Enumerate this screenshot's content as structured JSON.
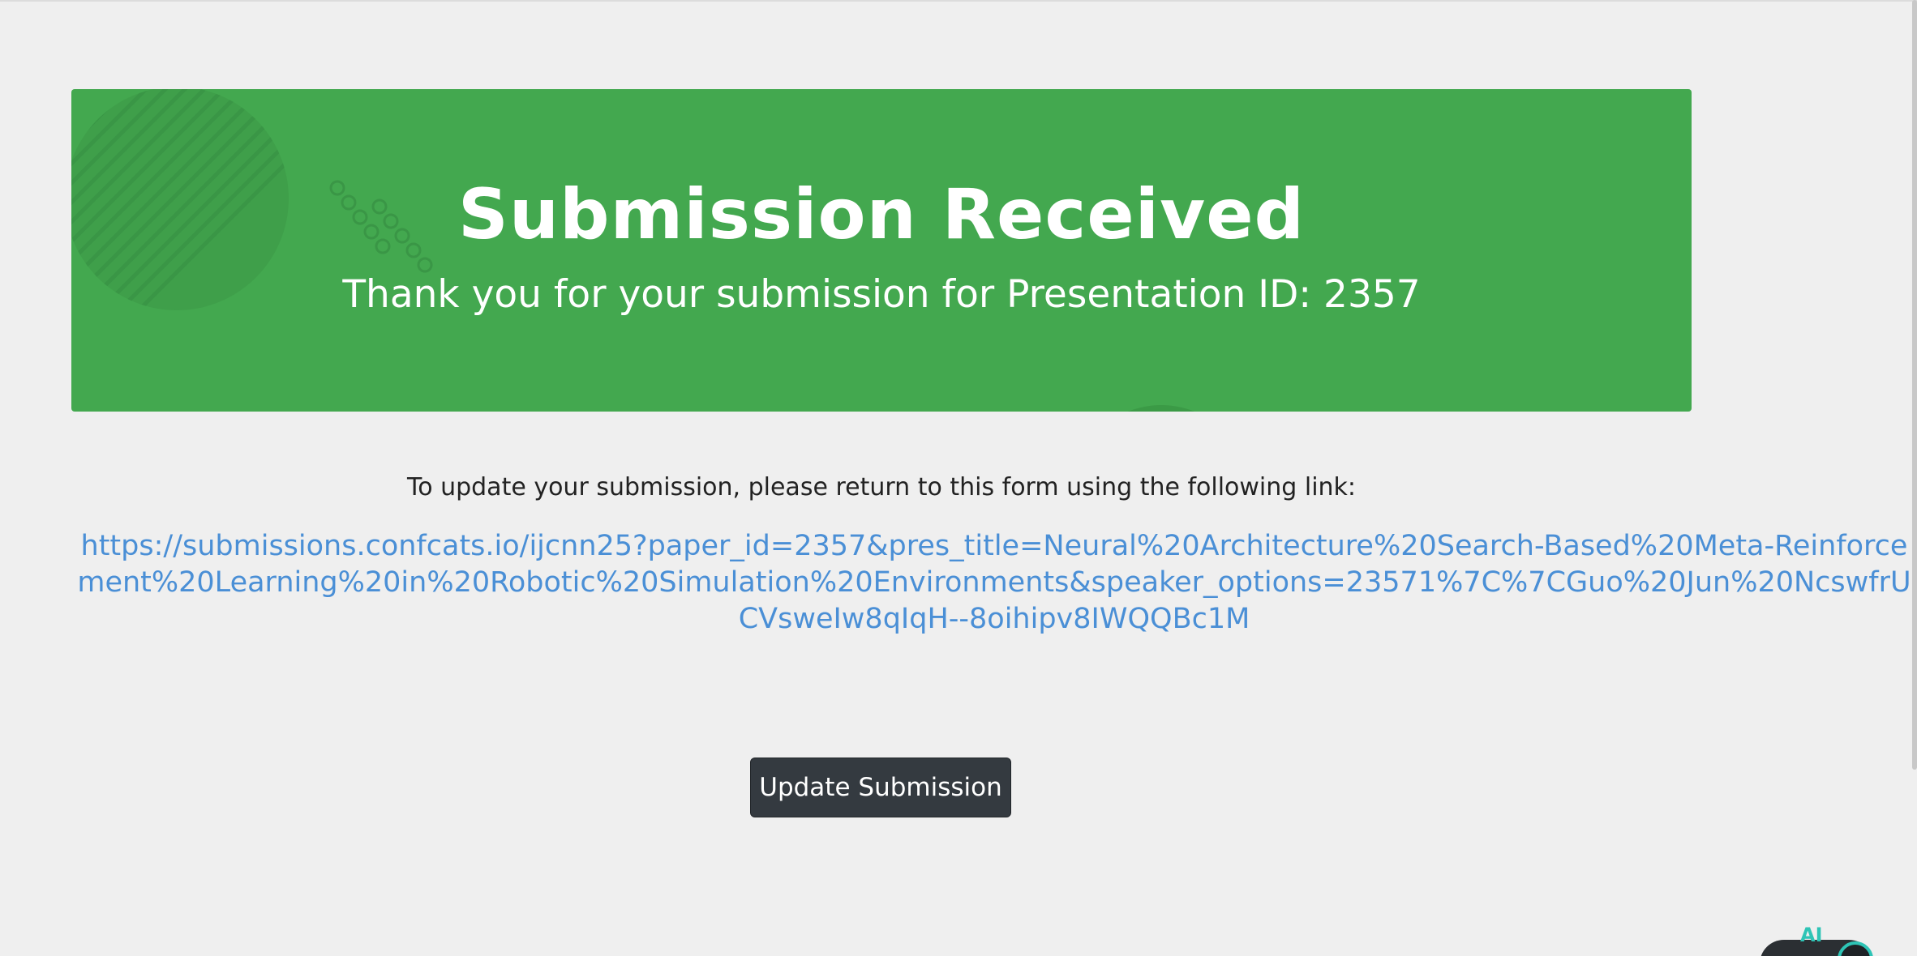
{
  "banner": {
    "title": "Submission Received",
    "subtitle": "Thank you for your submission for Presentation ID: 2357",
    "background_color": "#43a84f"
  },
  "main": {
    "instructions": "To update your submission, please return to this form using the following link:",
    "update_link": "https://submissions.confcats.io/ijcnn25?paper_id=2357&pres_title=Neural%20Architecture%20Search-Based%20Meta-Reinforcement%20Learning%20in%20Robotic%20Simulation%20Environments&speaker_options=23571%7C%7CGuo%20Jun%20NcswfrUCVsweIw8qIqH--8oihipv8IWQQBc1M",
    "link_color": "#4a8fd6",
    "update_button_label": "Update Submission",
    "button_color": "#343a40"
  },
  "assistant_widget": {
    "label": "AI",
    "icon": "assistant-chat-icon",
    "accent_color": "#2ec4b6"
  }
}
